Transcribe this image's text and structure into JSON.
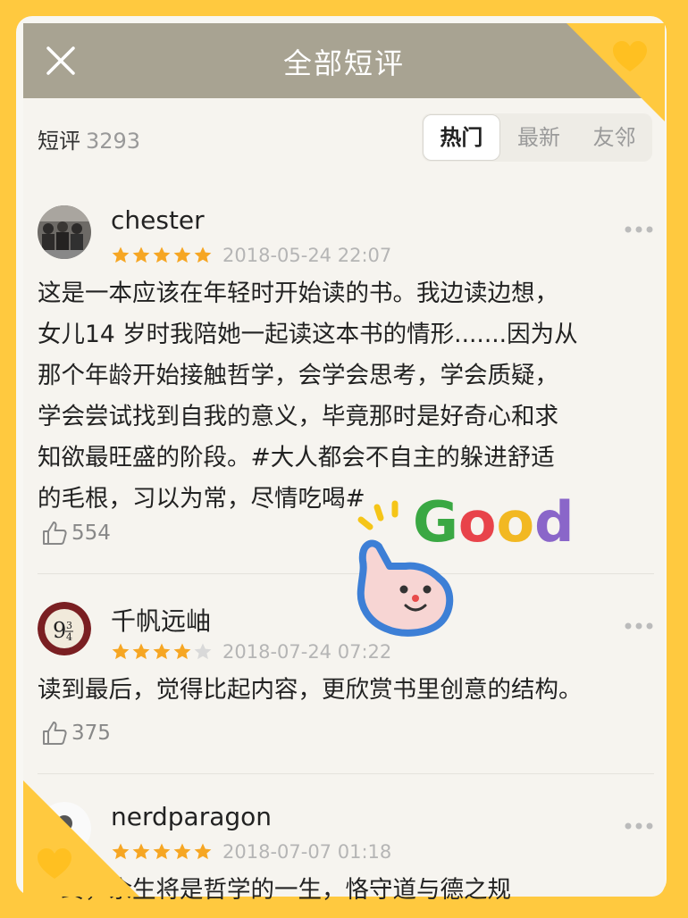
{
  "header": {
    "title": "全部短评"
  },
  "summary": {
    "label": "短评",
    "count": "3293"
  },
  "tabs": [
    {
      "label": "热门",
      "active": true
    },
    {
      "label": "最新",
      "active": false
    },
    {
      "label": "友邻",
      "active": false
    }
  ],
  "reviews": [
    {
      "user": "chester",
      "rating": 5,
      "date": "2018-05-24 22:07",
      "lines": [
        "这是一本应该在年轻时开始读的书。我边读边想，",
        "女儿14 岁时我陪她一起读这本书的情形.......因为从",
        "那个年龄开始接触哲学，会学会思考，学会质疑，",
        "学会尝试找到自我的意义，毕竟那时是好奇心和求",
        "知欲最旺盛的阶段。#大人都会不自主的躲进舒适",
        "的毛根，习以为常，尽情吃喝#"
      ],
      "likes": "554"
    },
    {
      "user": "千帆远岫",
      "rating": 4,
      "date": "2018-07-24 07:22",
      "lines": [
        "读到最后，觉得比起内容，更欣赏书里创意的结构。"
      ],
      "likes": "375"
    },
    {
      "user": "nerdparagon",
      "rating": 5,
      "date": "2018-07-07 01:18",
      "lines": [
        "一终，余生将是哲学的一生，恪守道与德之规"
      ]
    }
  ],
  "sticker": {
    "text": "Good"
  },
  "colors": {
    "background": "#ffc93f",
    "titlebar": "#a8a392",
    "star": "#f6a623",
    "star_empty": "#d9d9d9"
  }
}
